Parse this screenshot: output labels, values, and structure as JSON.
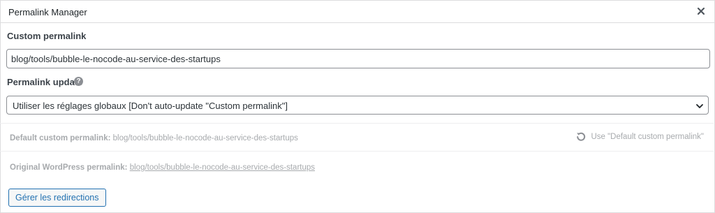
{
  "dialog": {
    "title": "Permalink Manager",
    "close_icon": "close-icon"
  },
  "custom_permalink": {
    "label": "Custom permalink",
    "value": "blog/tools/bubble-le-nocode-au-service-des-startups"
  },
  "permalink_update": {
    "label": "Permalink update",
    "help_icon": "help-icon",
    "help_symbol": "?",
    "selected": "Utiliser les réglages globaux [Don't auto-update \"Custom permalink\"]"
  },
  "default_custom_permalink": {
    "label": "Default custom permalink:",
    "value": "blog/tools/bubble-le-nocode-au-service-des-startups",
    "use_label": "Use \"Default custom permalink\"",
    "use_icon": "undo-icon"
  },
  "original_permalink": {
    "label": "Original WordPress permalink:",
    "link_part1": "blog/tools/",
    "link_part2": "bubble-le-nocode-au-service-des-startups"
  },
  "actions": {
    "redirects_label": "Gérer les redirections"
  },
  "colors": {
    "accent": "#2271b1",
    "border": "#dcdcde",
    "muted_text": "#a7aaad"
  }
}
